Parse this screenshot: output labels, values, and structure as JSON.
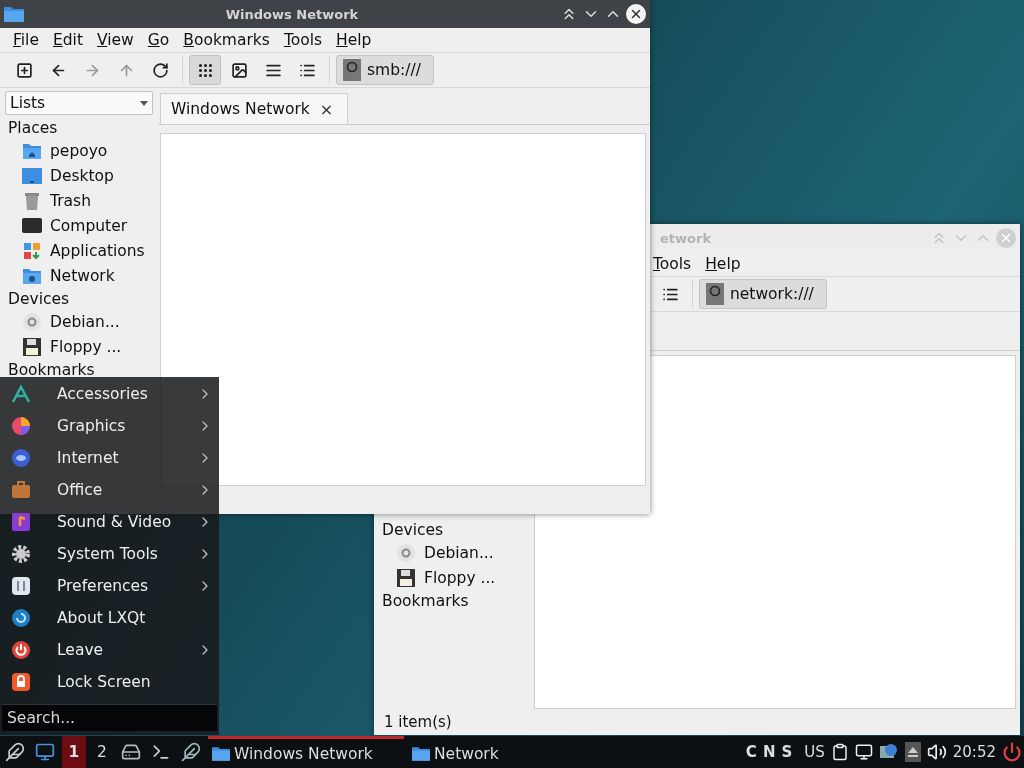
{
  "front_window": {
    "title": "Windows Network",
    "menu": [
      "File",
      "Edit",
      "View",
      "Go",
      "Bookmarks",
      "Tools",
      "Help"
    ],
    "nav_buttons": [
      {
        "disabled": false
      },
      {
        "disabled": false
      },
      {
        "disabled": true
      },
      {
        "disabled": true
      },
      {
        "disabled": false
      }
    ],
    "view_buttons": [
      {
        "selected": true
      },
      {
        "selected": false
      },
      {
        "selected": false
      },
      {
        "selected": false
      }
    ],
    "address": "smb:///",
    "side_panel": {
      "mode": "Lists",
      "sections": [
        {
          "title": "Places",
          "items": [
            {
              "label": "pepoyo",
              "kind": "home"
            },
            {
              "label": "Desktop",
              "kind": "desktop"
            },
            {
              "label": "Trash",
              "kind": "trash"
            },
            {
              "label": "Computer",
              "kind": "computer"
            },
            {
              "label": "Applications",
              "kind": "applications"
            },
            {
              "label": "Network",
              "kind": "network"
            }
          ]
        },
        {
          "title": "Devices",
          "items": [
            {
              "label": "Debian...",
              "kind": "disc"
            },
            {
              "label": "Floppy ...",
              "kind": "floppy"
            }
          ]
        },
        {
          "title": "Bookmarks"
        }
      ]
    },
    "tabs": [
      {
        "label": "Windows Network",
        "close": "×",
        "selected": true
      }
    ]
  },
  "back_window": {
    "title": "etwork",
    "menu": [
      "Tools",
      "Help"
    ],
    "address": "network:///",
    "sections": [
      {
        "title": "Devices",
        "items": [
          {
            "label": "Debian...",
            "kind": "disc"
          },
          {
            "label": "Floppy ...",
            "kind": "floppy"
          }
        ]
      },
      {
        "title": "Bookmarks"
      }
    ],
    "status": "1 item(s)"
  },
  "start_menu": {
    "items": [
      {
        "label": "Accessories",
        "kind": "accessories",
        "submenu": true
      },
      {
        "label": "Graphics",
        "kind": "graphics",
        "submenu": true
      },
      {
        "label": "Internet",
        "kind": "internet",
        "submenu": true
      },
      {
        "label": "Office",
        "kind": "office",
        "submenu": true
      },
      {
        "label": "Sound & Video",
        "kind": "sound",
        "submenu": true
      },
      {
        "label": "System Tools",
        "kind": "system",
        "submenu": true
      },
      {
        "label": "Preferences",
        "kind": "preferences",
        "submenu": true
      },
      {
        "label": "About LXQt",
        "kind": "about",
        "submenu": false
      },
      {
        "label": "Leave",
        "kind": "leave",
        "submenu": true
      },
      {
        "label": "Lock Screen",
        "kind": "lock",
        "submenu": false
      }
    ],
    "search": {
      "placeholder": "Search..."
    }
  },
  "taskbar": {
    "desktops": [
      {
        "label": "1",
        "selected": true
      },
      {
        "label": "2",
        "selected": false
      }
    ],
    "tasks": [
      {
        "label": "Windows Network",
        "selected": true
      },
      {
        "label": "Network",
        "selected": false
      }
    ],
    "lock_keys": [
      "C",
      "N",
      "S"
    ],
    "layout": "US",
    "clock": "20:52"
  }
}
